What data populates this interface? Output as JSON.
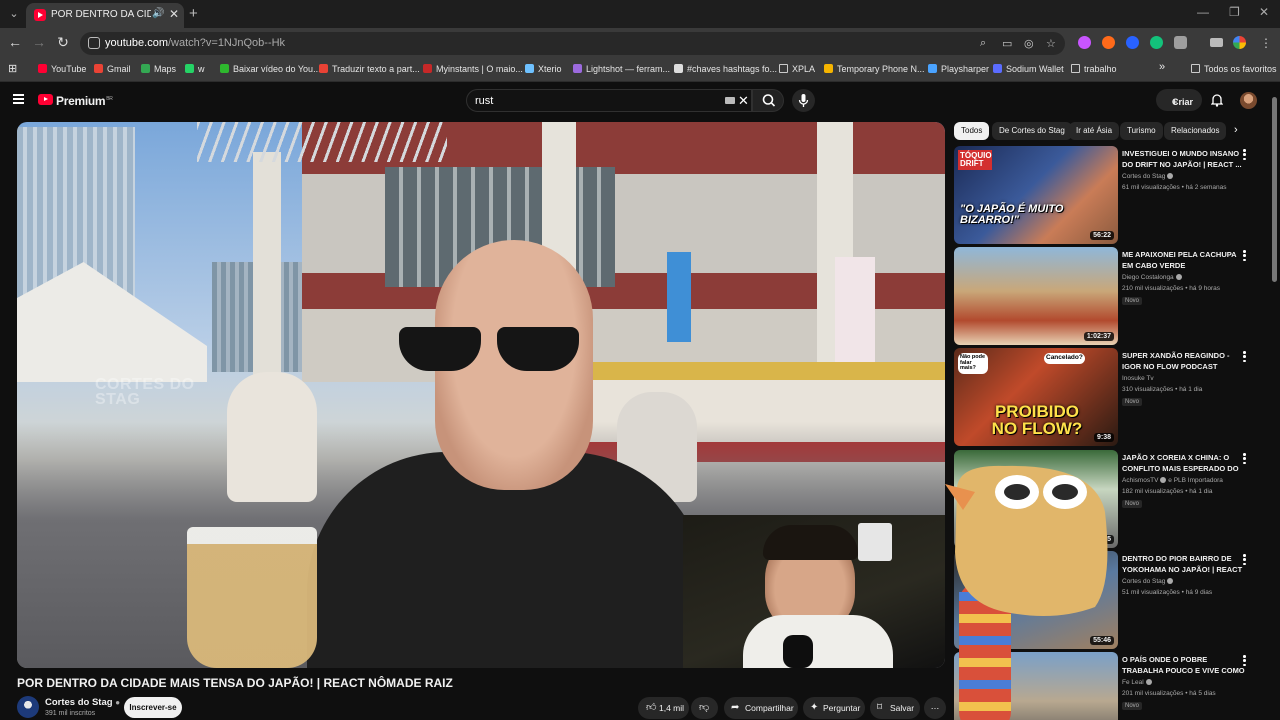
{
  "browser": {
    "tab": {
      "title": "POR DENTRO DA CIDADE MAIS TENSA DO JAPÃO! | REACT NÔMADE RAIZ"
    },
    "url": {
      "host": "youtube.com",
      "path": "/watch?v=1NJnQob--Hk"
    },
    "bookmarks": [
      {
        "label": "YouTube",
        "color": "#ff0033"
      },
      {
        "label": "Gmail",
        "color": "#ea4335"
      },
      {
        "label": "Maps",
        "color": "#34a853"
      },
      {
        "label": "w",
        "color": "#25d366"
      },
      {
        "label": "Baixar vídeo do You...",
        "color": "#2eb82e"
      },
      {
        "label": "Traduzir texto a part...",
        "color": "#e94235"
      },
      {
        "label": "Myinstants | O maio...",
        "color": "#c62828"
      },
      {
        "label": "Xterio",
        "color": "#6ec1ff"
      },
      {
        "label": "Lightshot — ferram...",
        "color": "#9c6ade"
      },
      {
        "label": "#chaves hashtags fo...",
        "color": "#dddddd"
      },
      {
        "label": "XPLA",
        "color": "folder"
      },
      {
        "label": "Temporary Phone N...",
        "color": "#f5b400"
      },
      {
        "label": "Playsharper",
        "color": "#4aa3ff"
      },
      {
        "label": "Sodium Wallet",
        "color": "#5b6cff"
      },
      {
        "label": "trabalho",
        "color": "folder"
      }
    ],
    "favorites_label": "Todos os favoritos"
  },
  "youtube": {
    "brand": "Premium",
    "brand_region": "BR",
    "search_query": "rust",
    "create_label": "Criar"
  },
  "video": {
    "watermark": "CORTES DO\nSTAG",
    "title": "POR DENTRO DA CIDADE MAIS TENSA DO JAPÃO! | REACT NÔMADE RAIZ",
    "channel": "Cortes do Stag",
    "subscribers": "391 mil inscritos",
    "subscribe_label": "Inscrever-se",
    "likes": "1,4 mil",
    "share_label": "Compartilhar",
    "ask_label": "Perguntar",
    "save_label": "Salvar"
  },
  "chips": [
    "Todos",
    "De Cortes do Stag",
    "Ir até Ásia",
    "Turismo",
    "Relacionados"
  ],
  "recommendations": [
    {
      "title": "INVESTIGUEI O MUNDO INSANO DO DRIFT NO JAPÃO! | REACT ...",
      "channel": "Cortes do Stag",
      "verified": true,
      "meta": "61 mil visualizações • há 2 semanas",
      "badge": "",
      "duration": "56:22",
      "thumb_text": "\"O JAPÃO É MUITO BIZARRO!\"",
      "thumb_tag": "TÓQUIO DRIFT"
    },
    {
      "title": "ME APAIXONEI PELA CACHUPA EM CABO VERDE",
      "channel": "Diego Costalonga",
      "verified": true,
      "meta": "210 mil visualizações • há 9 horas",
      "badge": "Novo",
      "duration": "1:02:37",
      "thumb_text": "",
      "thumb_tag": ""
    },
    {
      "title": "SUPER XANDÃO REAGINDO - IGOR NO FLOW PODCAST FALANDO ...",
      "channel": "Inosuke Tv",
      "verified": false,
      "meta": "310 visualizações • há 1 dia",
      "badge": "Novo",
      "duration": "9:38",
      "thumb_text": "PROIBIDO NO FLOW?",
      "thumb_tag": "Cancelado?",
      "thumb_tag2": "Não pode falar mais?"
    },
    {
      "title": "JAPÃO X COREIA X CHINA: O CONFLITO MAIS ESPERADO DO ...",
      "channel": "AchismosTV",
      "verified": true,
      "channel_extra": "e PLB Importadora",
      "meta": "182 mil visualizações • há 1 dia",
      "badge": "Novo",
      "duration": "00:45",
      "thumb_text": "",
      "thumb_tag": ""
    },
    {
      "title": "DENTRO DO PIOR BAIRRO DE YOKOHAMA NO JAPÃO! | REACT ...",
      "channel": "Cortes do Stag",
      "verified": true,
      "meta": "51 mil visualizações • há 9 dias",
      "badge": "",
      "duration": "55:46",
      "thumb_text": "",
      "thumb_tag": ""
    },
    {
      "title": "O PAÍS ONDE O POBRE TRABALHA POUCO E VIVE COMO RICO",
      "channel": "Fe Leal",
      "verified": true,
      "meta": "201 mil visualizações • há 5 dias",
      "badge": "Novo",
      "duration": "",
      "thumb_text": "",
      "thumb_tag": ""
    }
  ],
  "colors": {
    "accent": "#ff0033",
    "background": "#0f0f0f",
    "chip": "#272727",
    "text": "#f1f1f1",
    "muted": "#aaaaaa"
  }
}
